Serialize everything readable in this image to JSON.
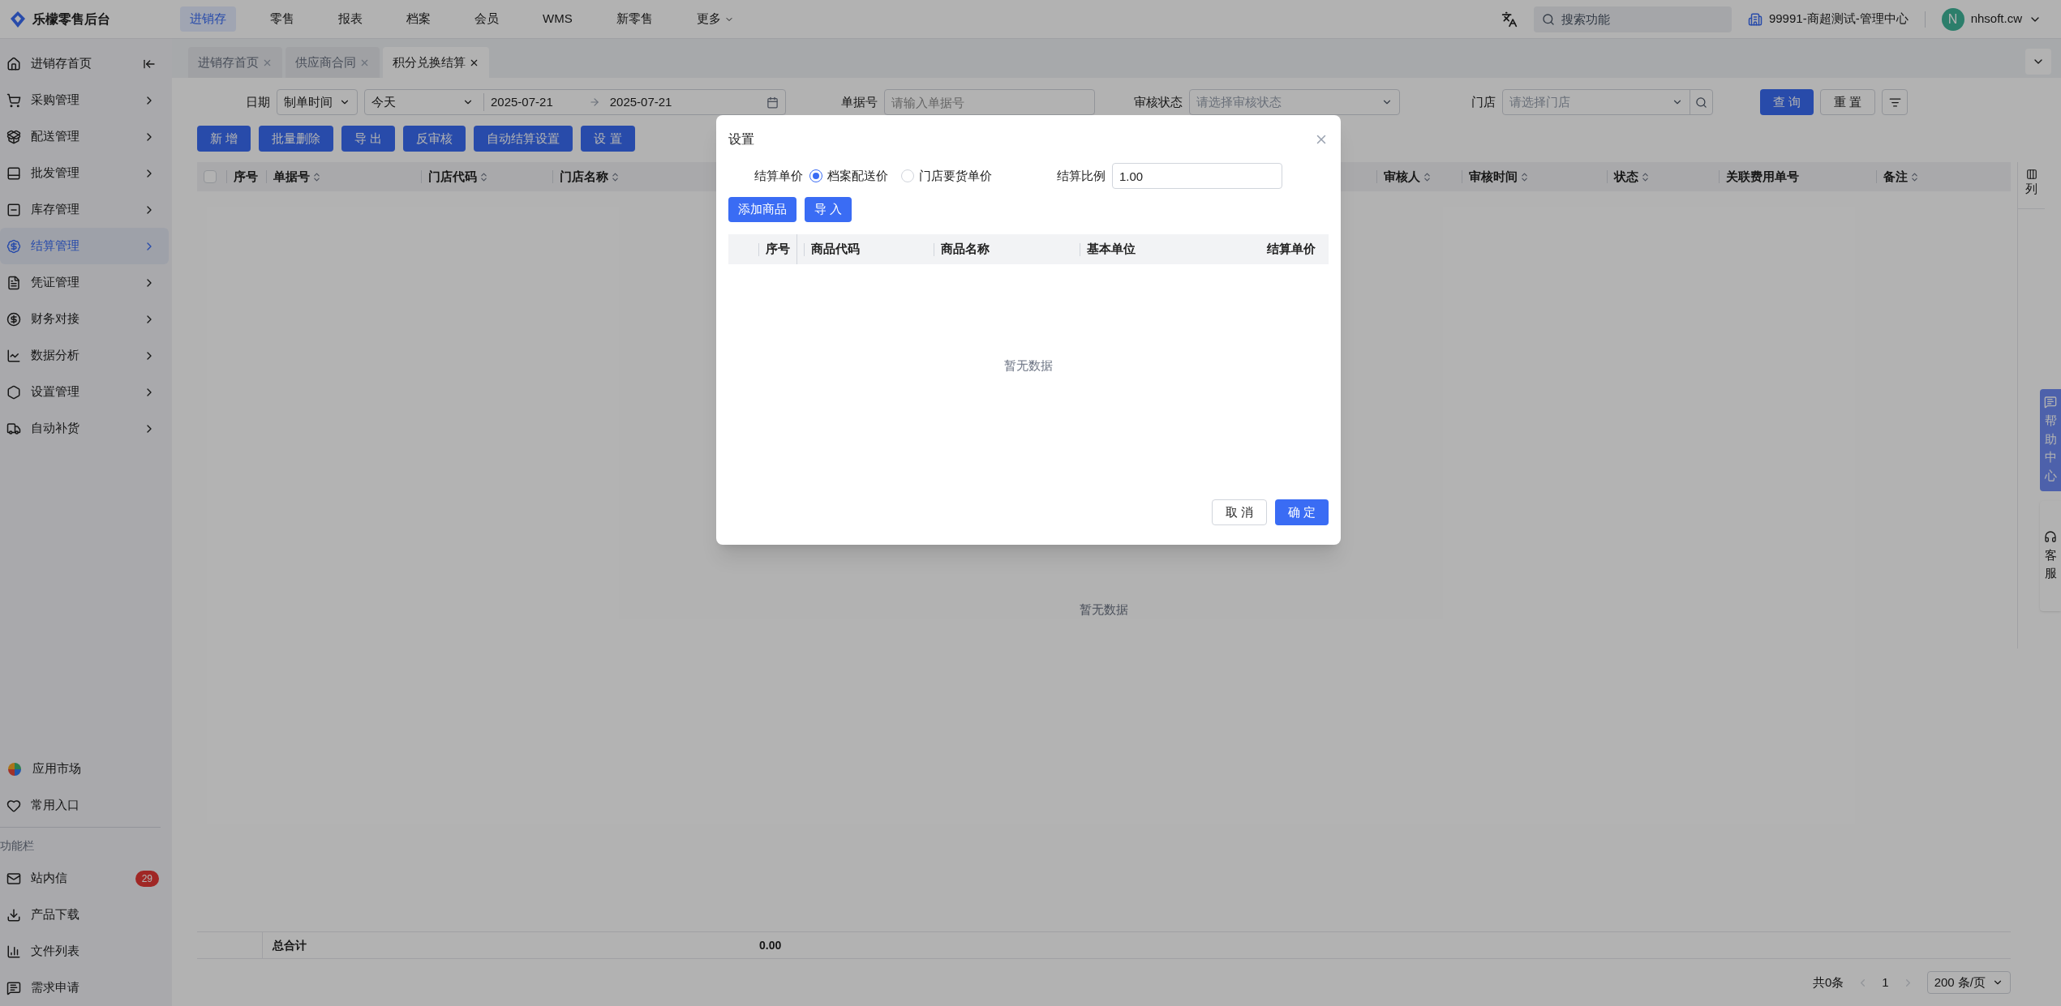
{
  "app": {
    "title": "乐檬零售后台"
  },
  "top_nav": [
    {
      "label": "进销存",
      "selected": true,
      "kind": "link"
    },
    {
      "label": "零售",
      "selected": false,
      "kind": "link"
    },
    {
      "label": "报表",
      "selected": false,
      "kind": "link"
    },
    {
      "label": "档案",
      "selected": false,
      "kind": "link"
    },
    {
      "label": "会员",
      "selected": false,
      "kind": "link"
    },
    {
      "label": "WMS",
      "selected": false,
      "kind": "link"
    },
    {
      "label": "新零售",
      "selected": false,
      "kind": "link"
    },
    {
      "label": "更多",
      "selected": false,
      "kind": "dropdown"
    }
  ],
  "header": {
    "search_placeholder": "搜索功能",
    "org": "99991-商超测试-管理中心",
    "avatar": "N",
    "user": "nhsoft.cw"
  },
  "sidebar": {
    "items": [
      {
        "label": "进销存首页",
        "selected": false,
        "kind": "home"
      },
      {
        "label": "采购管理",
        "selected": false,
        "kind": "menu"
      },
      {
        "label": "配送管理",
        "selected": false,
        "kind": "menu"
      },
      {
        "label": "批发管理",
        "selected": false,
        "kind": "menu"
      },
      {
        "label": "库存管理",
        "selected": false,
        "kind": "menu"
      },
      {
        "label": "结算管理",
        "selected": true,
        "kind": "menu"
      },
      {
        "label": "凭证管理",
        "selected": false,
        "kind": "menu"
      },
      {
        "label": "财务对接",
        "selected": false,
        "kind": "menu"
      },
      {
        "label": "数据分析",
        "selected": false,
        "kind": "menu"
      },
      {
        "label": "设置管理",
        "selected": false,
        "kind": "menu"
      },
      {
        "label": "自动补货",
        "selected": false,
        "kind": "menu"
      }
    ],
    "bottom_items": [
      {
        "label": "应用市场"
      },
      {
        "label": "常用入口"
      }
    ],
    "section_label": "功能栏",
    "tools": [
      {
        "label": "站内信",
        "badge": "29"
      },
      {
        "label": "产品下载"
      },
      {
        "label": "文件列表"
      },
      {
        "label": "需求申请"
      }
    ]
  },
  "tabs": [
    {
      "label": "进销存首页",
      "selected": false
    },
    {
      "label": "供应商合同",
      "selected": false
    },
    {
      "label": "积分兑换结算",
      "selected": true
    }
  ],
  "filters": {
    "date_label": "日期",
    "date_type": "制单时间",
    "date_preset": "今天",
    "start_date": "2025-07-21",
    "end_date": "2025-07-21",
    "doc_label": "单据号",
    "doc_placeholder": "请输入单据号",
    "status_label": "审核状态",
    "status_placeholder": "请选择审核状态",
    "store_label": "门店",
    "store_placeholder": "请选择门店",
    "query_button": "查 询",
    "reset_button": "重 置"
  },
  "actions": [
    "新 增",
    "批量删除",
    "导 出",
    "反审核",
    "自动结算设置",
    "设 置"
  ],
  "table": {
    "columns": [
      {
        "label": "序号",
        "sortable": false
      },
      {
        "label": "单据号",
        "sortable": true
      },
      {
        "label": "门店代码",
        "sortable": true
      },
      {
        "label": "门店名称",
        "sortable": true
      },
      {
        "label": "审核人",
        "sortable": true
      },
      {
        "label": "审核时间",
        "sortable": true
      },
      {
        "label": "状态",
        "sortable": true
      },
      {
        "label": "关联费用单号",
        "sortable": false
      },
      {
        "label": "备注",
        "sortable": true
      }
    ],
    "select_all_checked": false,
    "column_toggle": "列",
    "empty": "暂无数据",
    "total_label": "总合计",
    "total_value": "0.00"
  },
  "pagination": {
    "total": "共0条",
    "page": "1",
    "page_size": "200 条/页"
  },
  "float_buttons": {
    "help": "帮助中心",
    "service": "客服"
  },
  "dialog": {
    "title": "设置",
    "price_label": "结算单价",
    "radios": [
      {
        "label": "档案配送价",
        "selected": true
      },
      {
        "label": "门店要货单价",
        "selected": false
      }
    ],
    "ratio_label": "结算比例",
    "ratio_value": "1.00",
    "buttons": [
      "添加商品",
      "导 入"
    ],
    "columns": [
      "序号",
      "商品代码",
      "商品名称",
      "基本单位",
      "结算单价"
    ],
    "empty": "暂无数据",
    "cancel": "取 消",
    "ok": "确 定"
  }
}
